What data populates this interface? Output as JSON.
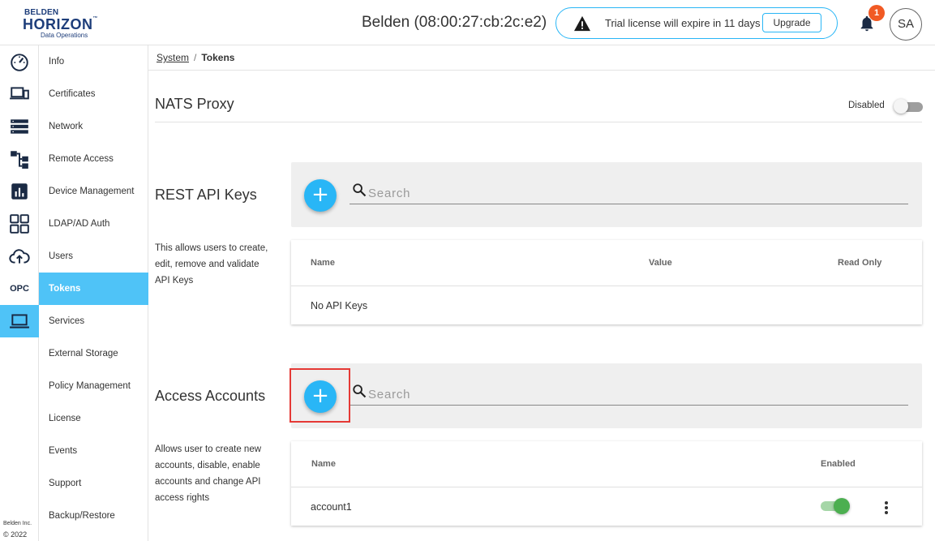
{
  "header": {
    "logo": {
      "line1": "BELDEN",
      "line2": "HORIZON",
      "tm": "™",
      "line3": "Data Operations"
    },
    "device_title": "Belden (08:00:27:cb:2c:e2)",
    "license_text": "Trial license will expire in 11 days",
    "upgrade_label": "Upgrade",
    "notification_count": "1",
    "avatar_initials": "SA"
  },
  "rail": {
    "icons": [
      "dashboard-icon",
      "devices-icon",
      "list-icon",
      "hierarchy-icon",
      "chart-icon",
      "apps-icon",
      "cloud-upload-icon",
      "opc-icon",
      "laptop-icon"
    ],
    "opc_label": "OPC",
    "active_index": 8,
    "footer_line1": "Belden Inc.",
    "footer_line2": "© 2022"
  },
  "subnav": {
    "items": [
      "Info",
      "Certificates",
      "Network",
      "Remote Access",
      "Device Management",
      "LDAP/AD Auth",
      "Users",
      "Tokens",
      "Services",
      "External Storage",
      "Policy Management",
      "License",
      "Events",
      "Support",
      "Backup/Restore"
    ],
    "active": "Tokens"
  },
  "breadcrumb": {
    "parent": "System",
    "separator": "/",
    "current": "Tokens"
  },
  "nats": {
    "title": "NATS Proxy",
    "status": "Disabled",
    "enabled": false
  },
  "rest_api": {
    "title": "REST API Keys",
    "description": "This allows users to create, edit, remove and validate API Keys",
    "search_placeholder": "Search",
    "columns": {
      "name": "Name",
      "value": "Value",
      "read_only": "Read Only"
    },
    "empty_text": "No API Keys"
  },
  "access_accounts": {
    "title": "Access Accounts",
    "description": "Allows user to create new accounts, disable, enable accounts and change API access rights",
    "search_placeholder": "Search",
    "columns": {
      "name": "Name",
      "enabled": "Enabled"
    },
    "rows": [
      {
        "name": "account1",
        "enabled": true
      }
    ]
  },
  "colors": {
    "accent": "#29b6f6",
    "active_nav": "#4fc3f7",
    "badge": "#f15a24",
    "toggle_on": "#4caf50",
    "highlight": "#e53935"
  }
}
